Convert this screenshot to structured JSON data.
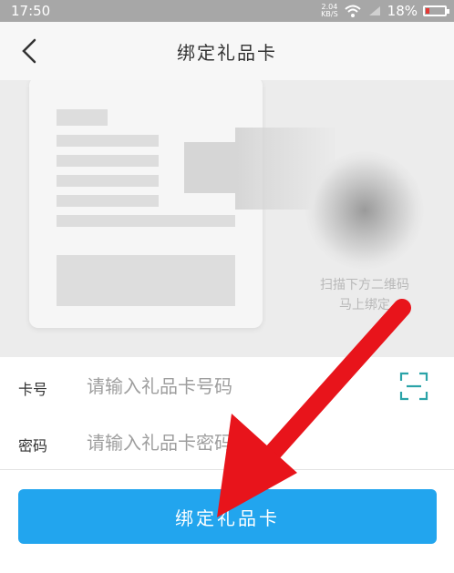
{
  "status_bar": {
    "time": "17:50",
    "net_speed_value": "2.04",
    "net_speed_unit": "KB/S",
    "battery": "18%"
  },
  "header": {
    "title": "绑定礼品卡"
  },
  "illustration": {
    "hint_line1": "扫描下方二维码",
    "hint_line2": "马上绑定"
  },
  "form": {
    "card_label": "卡号",
    "card_placeholder": "请输入礼品卡号码",
    "pwd_label": "密码",
    "pwd_placeholder": "请输入礼品卡密码"
  },
  "submit": {
    "label": "绑定礼品卡"
  },
  "colors": {
    "primary": "#22a5ee",
    "annotation_arrow": "#e8141b"
  },
  "icons": [
    "back-icon",
    "scan-icon",
    "wifi-icon",
    "battery-icon"
  ]
}
